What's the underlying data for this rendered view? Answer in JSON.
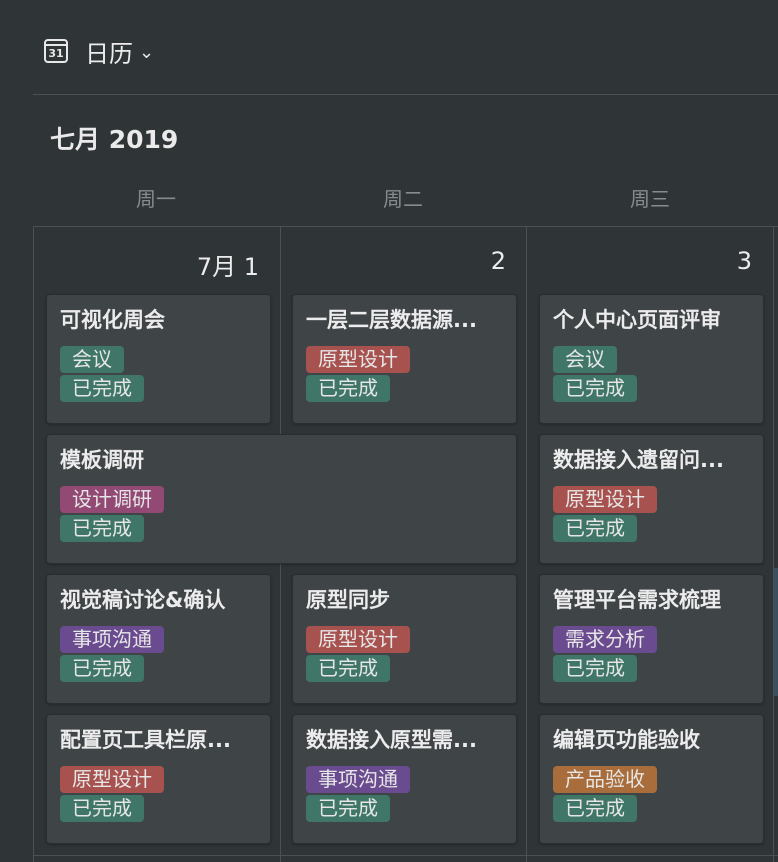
{
  "header": {
    "icon_text": "31",
    "title": "日历",
    "chevron": "⌄"
  },
  "month_label": "七月 2019",
  "weekdays": [
    "周一",
    "周二",
    "周三"
  ],
  "day_numbers": [
    "7月 1",
    "2",
    "3"
  ],
  "colors": {
    "meeting": "#3f7668",
    "done": "#3f7668",
    "prototype": "#a7524e",
    "research": "#924a75",
    "communication": "#6b4b90",
    "requirements": "#6b4b90",
    "acceptance": "#a86d3a"
  },
  "events": {
    "mon1": {
      "title": "可视化周会",
      "tag": "会议",
      "status": "已完成"
    },
    "tue1": {
      "title": "一层二层数据源...",
      "tag": "原型设计",
      "status": "已完成"
    },
    "wed1": {
      "title": "个人中心页面评审",
      "tag": "会议",
      "status": "已完成"
    },
    "montue2": {
      "title": "模板调研",
      "tag": "设计调研",
      "status": "已完成"
    },
    "wed2": {
      "title": "数据接入遗留问...",
      "tag": "原型设计",
      "status": "已完成"
    },
    "mon3": {
      "title": "视觉稿讨论&确认",
      "tag": "事项沟通",
      "status": "已完成"
    },
    "tue3": {
      "title": "原型同步",
      "tag": "原型设计",
      "status": "已完成"
    },
    "wed3": {
      "title": "管理平台需求梳理",
      "tag": "需求分析",
      "status": "已完成"
    },
    "mon4": {
      "title": "配置页工具栏原...",
      "tag": "原型设计",
      "status": "已完成"
    },
    "tue4": {
      "title": "数据接入原型需...",
      "tag": "事项沟通",
      "status": "已完成"
    },
    "wed4": {
      "title": "编辑页功能验收",
      "tag": "产品验收",
      "status": "已完成"
    }
  }
}
